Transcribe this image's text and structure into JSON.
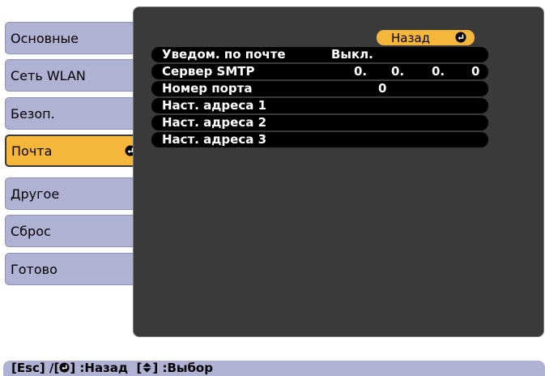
{
  "sidebar": {
    "items": [
      {
        "label": "Основные"
      },
      {
        "label": "Сеть WLAN"
      },
      {
        "label": "Безоп."
      },
      {
        "label": "Почта"
      },
      {
        "label": "Другое"
      },
      {
        "label": "Сброс"
      },
      {
        "label": "Готово"
      }
    ],
    "selected": "Почта"
  },
  "panel": {
    "back_label": "Назад",
    "rows": {
      "notification": {
        "label": "Уведом. по почте",
        "value": "Выкл."
      },
      "smtp": {
        "label": "Сервер SMTP",
        "ip": [
          "0.",
          "0.",
          "0.",
          "0"
        ]
      },
      "port": {
        "label": "Номер порта",
        "value": "0"
      },
      "addr1": {
        "label": "Наст. адреса 1"
      },
      "addr2": {
        "label": "Наст. адреса 2"
      },
      "addr3": {
        "label": "Наст. адреса 3"
      }
    }
  },
  "helpbar": {
    "esc": "[Esc] /[",
    "back": "] :Назад",
    "select_open": "[",
    "select": "] :Выбор"
  },
  "colors": {
    "tab": "#b0b2d4",
    "selected": "#f4b63b",
    "panel": "#3a3a3a",
    "row": "#000000"
  }
}
